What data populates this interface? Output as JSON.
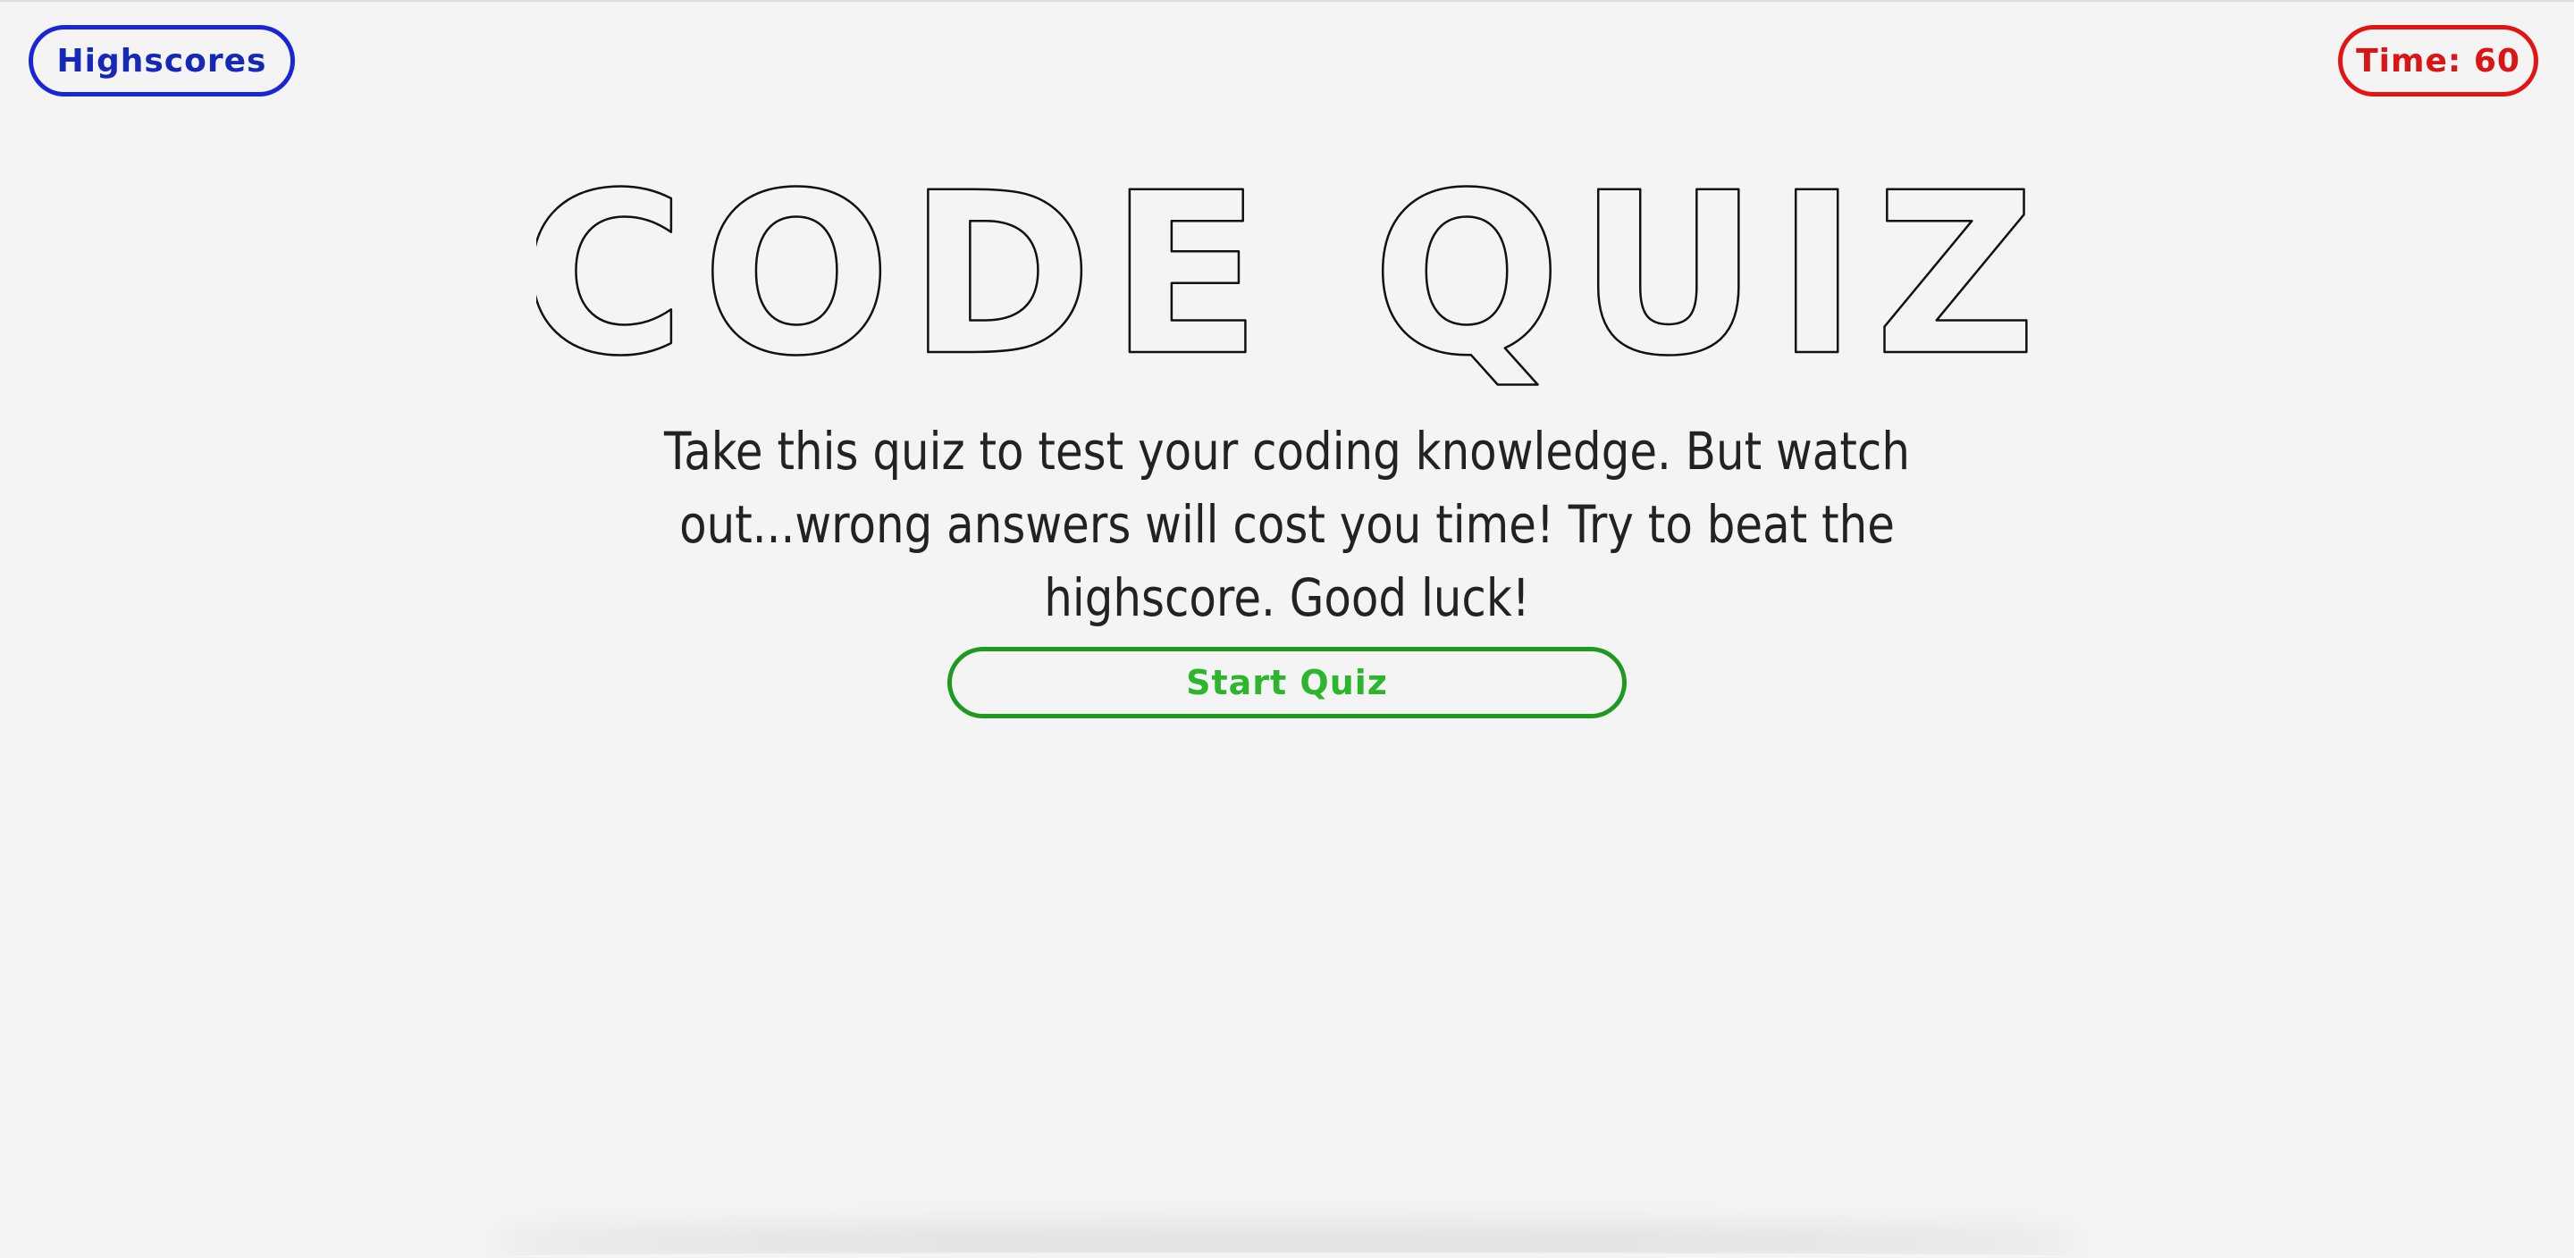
{
  "header": {
    "highscores_label": "Highscores",
    "timer_text": "Time: 60"
  },
  "main": {
    "title": "CODE QUIZ",
    "description": "Take this quiz to test your coding knowledge. But watch out...wrong answers will cost you time! Try to beat the highscore. Good luck!",
    "start_label": "Start Quiz"
  },
  "colors": {
    "highscores": "#1a25d6",
    "timer": "#e21414",
    "start": "#1e9a1e",
    "background": "#f4f4f4"
  }
}
